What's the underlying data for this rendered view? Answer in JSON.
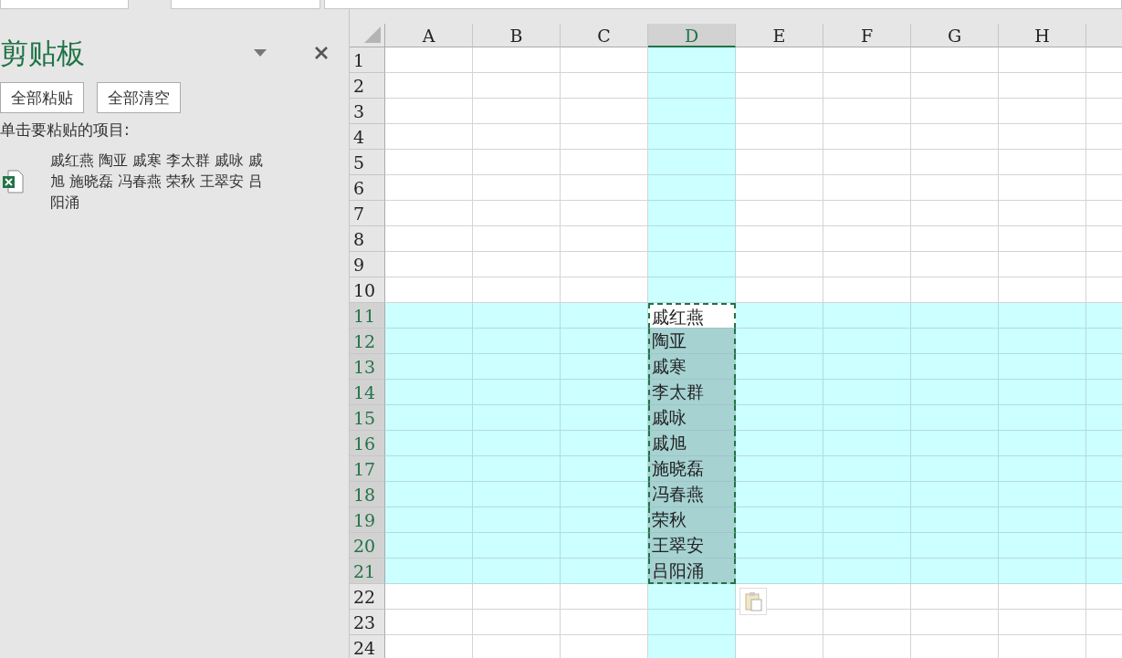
{
  "clipboard_pane": {
    "title": "剪贴板",
    "buttons": [
      "全部粘贴",
      "全部清空"
    ],
    "instruction": "单击要粘贴的项目:",
    "items": [
      {
        "kind": "excel",
        "text": "戚红燕 陶亚 戚寒 李太群 戚咏 戚旭 施晓磊 冯春燕 荣秋 王翠安 吕阳涌"
      }
    ]
  },
  "sheet": {
    "columns": [
      {
        "label": "A",
        "selected": false
      },
      {
        "label": "B",
        "selected": false
      },
      {
        "label": "C",
        "selected": false
      },
      {
        "label": "D",
        "selected": true
      },
      {
        "label": "E",
        "selected": false
      },
      {
        "label": "F",
        "selected": false
      },
      {
        "label": "G",
        "selected": false
      },
      {
        "label": "H",
        "selected": false
      }
    ],
    "rows": [
      {
        "label": "1",
        "selected": false,
        "active": false
      },
      {
        "label": "2",
        "selected": false,
        "active": false
      },
      {
        "label": "3",
        "selected": false,
        "active": false
      },
      {
        "label": "4",
        "selected": false,
        "active": false
      },
      {
        "label": "5",
        "selected": false,
        "active": false
      },
      {
        "label": "6",
        "selected": false,
        "active": false
      },
      {
        "label": "7",
        "selected": false,
        "active": false
      },
      {
        "label": "8",
        "selected": false,
        "active": false
      },
      {
        "label": "9",
        "selected": false,
        "active": false
      },
      {
        "label": "10",
        "selected": false,
        "active": false
      },
      {
        "label": "11",
        "selected": true,
        "active": true,
        "value": "戚红燕"
      },
      {
        "label": "12",
        "selected": true,
        "active": false,
        "value": "陶亚"
      },
      {
        "label": "13",
        "selected": true,
        "active": false,
        "value": "戚寒"
      },
      {
        "label": "14",
        "selected": true,
        "active": false,
        "value": "李太群"
      },
      {
        "label": "15",
        "selected": true,
        "active": false,
        "value": "戚咏"
      },
      {
        "label": "16",
        "selected": true,
        "active": false,
        "value": "戚旭"
      },
      {
        "label": "17",
        "selected": true,
        "active": false,
        "value": "施晓磊"
      },
      {
        "label": "18",
        "selected": true,
        "active": false,
        "value": "冯春燕"
      },
      {
        "label": "19",
        "selected": true,
        "active": false,
        "value": "荣秋"
      },
      {
        "label": "20",
        "selected": true,
        "active": false,
        "value": "王翠安"
      },
      {
        "label": "21",
        "selected": true,
        "active": false,
        "value": "吕阳涌"
      },
      {
        "label": "22",
        "selected": false,
        "active": false
      },
      {
        "label": "23",
        "selected": false,
        "active": false
      },
      {
        "label": "24",
        "selected": false,
        "active": false
      }
    ]
  }
}
